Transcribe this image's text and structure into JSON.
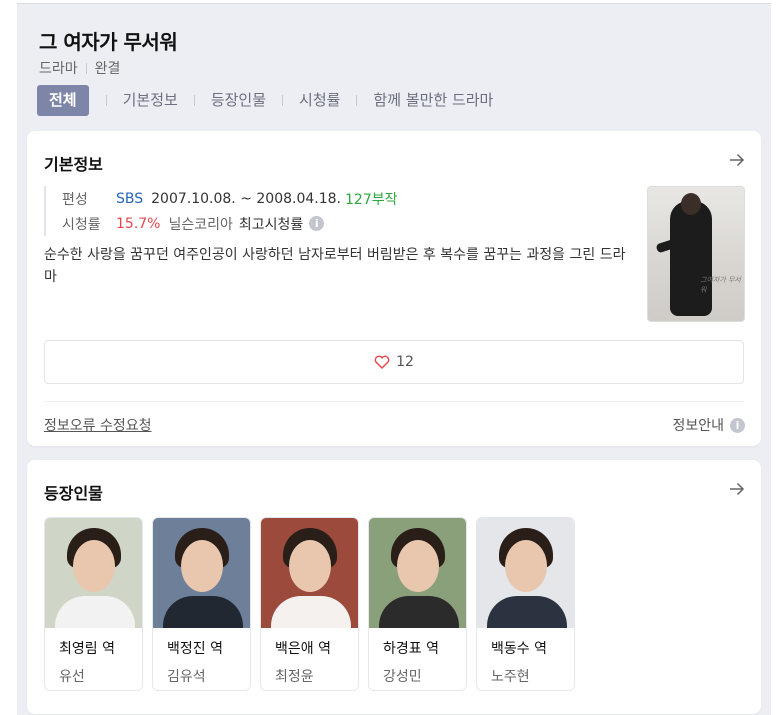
{
  "header": {
    "title": "그 여자가 무서워",
    "genre": "드라마",
    "status": "완결"
  },
  "tabs": [
    {
      "label": "전체",
      "active": true
    },
    {
      "label": "기본정보",
      "active": false
    },
    {
      "label": "등장인물",
      "active": false
    },
    {
      "label": "시청률",
      "active": false
    },
    {
      "label": "함께 볼만한 드라마",
      "active": false
    }
  ],
  "basic_info": {
    "section_title": "기본정보",
    "broadcast_label": "편성",
    "broadcaster": "SBS",
    "period": "2007.10.08. ~ 2008.04.18.",
    "episodes": "127부작",
    "rating_label": "시청률",
    "rating_value": "15.7%",
    "rating_source": "닐슨코리아",
    "rating_type": "최고시청률",
    "info_icon": "i",
    "description": "순수한 사랑을 꿈꾸던 여주인공이 사랑하던 남자로부터 버림받은 후 복수를 꿈꾸는 과정을 그린 드라마",
    "poster_text": "그여자가 무서워",
    "like_count": "12",
    "report_link": "정보오류 수정요청",
    "guide_link": "정보안내",
    "arrow_icon": "arrow-right-icon",
    "heart_icon": "heart-outline-icon"
  },
  "cast_section": {
    "section_title": "등장인물",
    "members": [
      {
        "role": "최영림 역",
        "actor": "유선",
        "bg": "#cfd6c8",
        "clothes": "#f2f2f2"
      },
      {
        "role": "백정진 역",
        "actor": "김유석",
        "bg": "#6d7f99",
        "clothes": "#222831"
      },
      {
        "role": "백은애 역",
        "actor": "최정윤",
        "bg": "#9b4a3c",
        "clothes": "#f4f1ee"
      },
      {
        "role": "하경표 역",
        "actor": "강성민",
        "bg": "#8aa07a",
        "clothes": "#2b2b2b"
      },
      {
        "role": "백동수 역",
        "actor": "노주현",
        "bg": "#e4e6ea",
        "clothes": "#2c3340"
      }
    ]
  },
  "colors": {
    "accent_tab": "#7d85a8",
    "broadcaster": "#2665b8",
    "episodes": "#2ea83e",
    "rating": "#e2484d",
    "heart": "#e2484d"
  }
}
